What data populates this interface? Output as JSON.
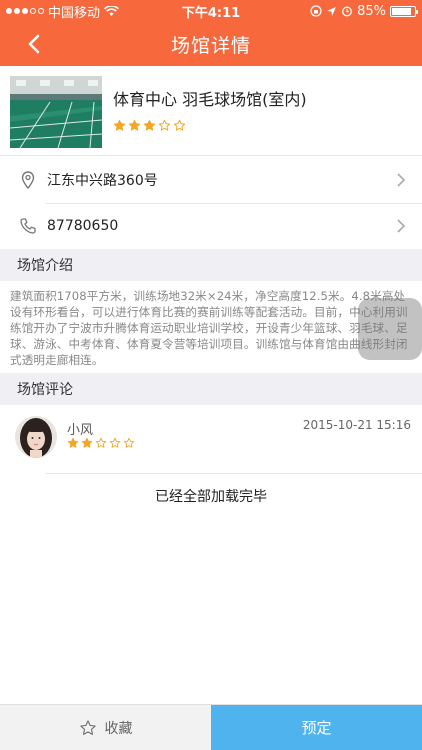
{
  "status_bar": {
    "carrier": "中国移动",
    "time": "下午4:11",
    "battery_percent": "85%",
    "battery_level": 0.85
  },
  "nav": {
    "title": "场馆详情",
    "back_icon": "chevron-left-icon"
  },
  "venue": {
    "name": "体育中心 羽毛球场馆(室内)",
    "rating": 3,
    "max_rating": 5
  },
  "address": {
    "icon": "location-pin-icon",
    "text": "江东中兴路360号"
  },
  "phone": {
    "icon": "phone-icon",
    "text": "87780650"
  },
  "sections": {
    "intro_title": "场馆介绍",
    "intro_text": "建筑面积1708平方米，训练场地32米×24米，净空高度12.5米。4.8米高处设有环形看台，可以进行体育比赛的赛前训练等配套活动。目前，中心利用训练馆开办了宁波市升腾体育运动职业培训学校，开设青少年篮球、羽毛球、足球、游泳、中考体育、体育夏令营等培训项目。训练馆与体育馆由曲线形封闭式透明走廊相连。",
    "comments_title": "场馆评论"
  },
  "comments": [
    {
      "user": "小风",
      "time": "2015-10-21 15:16",
      "rating": 2,
      "max_rating": 5
    }
  ],
  "load_done_text": "已经全部加载完毕",
  "bottom": {
    "favorite_label": "收藏",
    "favorite_icon": "star-outline-icon",
    "book_label": "预定"
  },
  "colors": {
    "accent": "#f7693d",
    "star": "#f5a623",
    "book_button": "#4fb3ee"
  }
}
